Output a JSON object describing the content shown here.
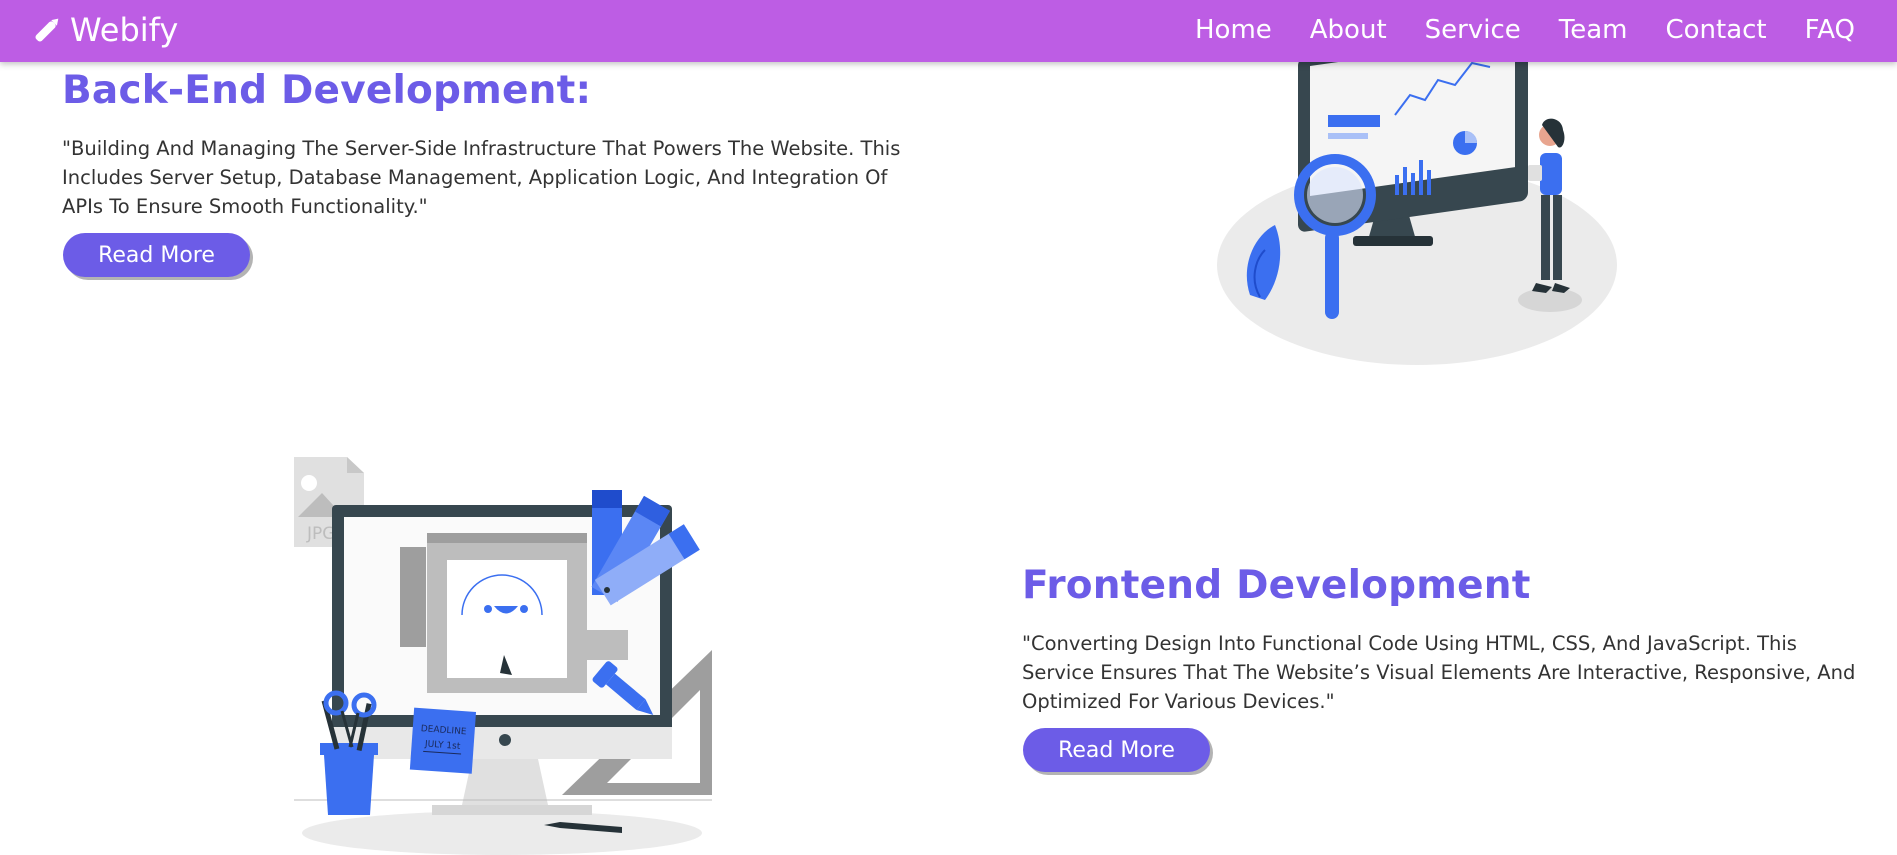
{
  "navbar": {
    "brand": "Webify",
    "links": [
      "Home",
      "About",
      "Service",
      "Team",
      "Contact",
      "FAQ"
    ]
  },
  "services": [
    {
      "title": "Back-End Development:",
      "description": "\"Building And Managing The Server-Side Infrastructure That Powers The Website. This Includes Server Setup, Database Management, Application Logic, And Integration Of APIs To Ensure Smooth Functionality.\"",
      "button": "Read More"
    },
    {
      "title": "Frontend Development",
      "description": "\"Converting Design Into Functional Code Using HTML, CSS, And JavaScript. This Service Ensures That The Website’s Visual Elements Are Interactive, Responsive, And Optimized For Various Devices.\"",
      "button": "Read More"
    }
  ],
  "illustration_text": {
    "file_type": "JPG",
    "deadline_label": "DEADLINE",
    "deadline_date": "JULY 1st"
  },
  "colors": {
    "navbar": "#bd5de4",
    "accent": "#6c5ce7",
    "illustration_blue": "#3b6ff0"
  },
  "icons": {
    "brand": "pencil-icon"
  }
}
